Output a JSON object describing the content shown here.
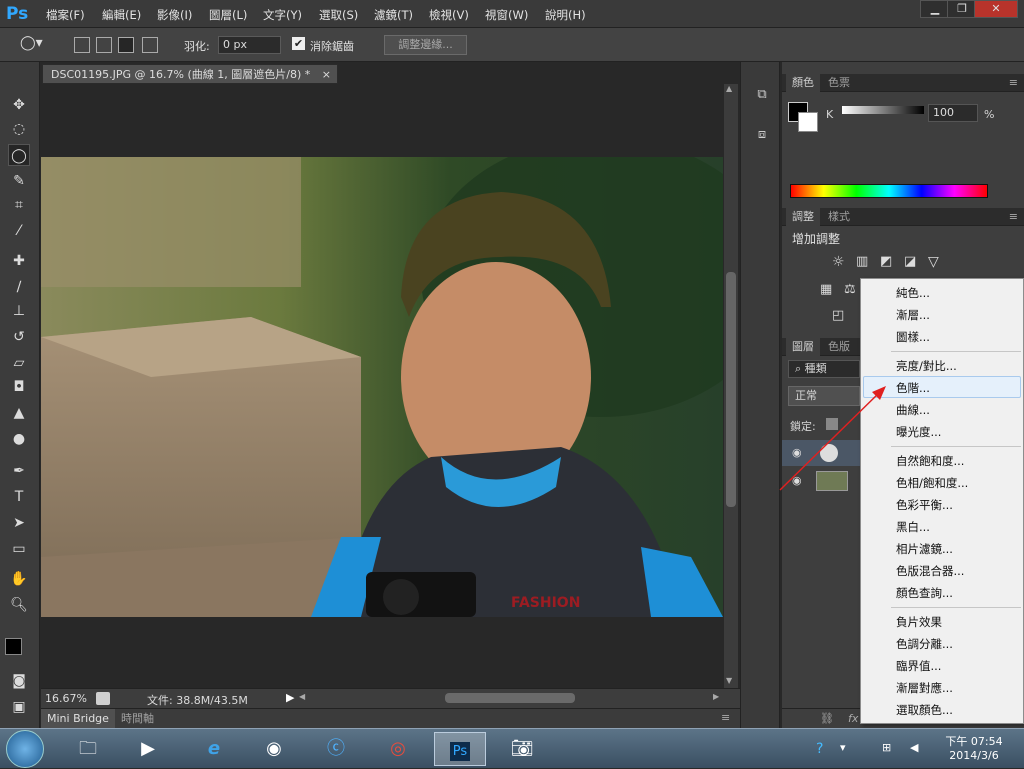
{
  "app": {
    "logo": "Ps"
  },
  "menu": [
    "檔案(F)",
    "編輯(E)",
    "影像(I)",
    "圖層(L)",
    "文字(Y)",
    "選取(S)",
    "濾鏡(T)",
    "檢視(V)",
    "視窗(W)",
    "說明(H)"
  ],
  "window_controls": {
    "minimize": "▁",
    "restore": "❐",
    "close": "✕"
  },
  "options": {
    "feather_label": "羽化:",
    "feather_value": "0 px",
    "antialias_label": "消除鋸齒",
    "antialias_checked": true,
    "refine_label": "調整邊緣..."
  },
  "document": {
    "tab_title": "DSC01195.JPG @ 16.7% (曲線 1, 圖層遮色片/8) *",
    "tab_close": "×",
    "zoom": "16.67%",
    "file_info": "文件: 38.8M/43.5M"
  },
  "bottom_tabs": [
    "Mini Bridge",
    "時間軸"
  ],
  "panels": {
    "color": {
      "tabs": [
        "顏色",
        "色票"
      ],
      "channel": "K",
      "value": "100",
      "unit": "%"
    },
    "adjust": {
      "tabs": [
        "調整",
        "樣式"
      ],
      "title": "增加調整"
    },
    "layers": {
      "tabs": [
        "圖層",
        "色版"
      ],
      "filter": "種類",
      "blend": "正常",
      "lock": "鎖定:"
    }
  },
  "context_menu": {
    "group1": [
      "純色...",
      "漸層...",
      "圖樣..."
    ],
    "group2": [
      "亮度/對比...",
      "色階...",
      "曲線...",
      "曝光度..."
    ],
    "group3": [
      "自然飽和度...",
      "色相/飽和度...",
      "色彩平衡...",
      "黑白...",
      "相片濾鏡...",
      "色版混合器...",
      "顏色查詢..."
    ],
    "group4": [
      "負片效果",
      "色調分離...",
      "臨界值...",
      "漸層對應...",
      "選取顏色..."
    ],
    "highlighted": "色階..."
  },
  "taskbar": {
    "time": "下午 07:54",
    "date": "2014/3/6"
  },
  "colors": {
    "accent": "#31a8ff",
    "menu_highlight": "#e5f0fb",
    "arrow": "#e02020"
  }
}
